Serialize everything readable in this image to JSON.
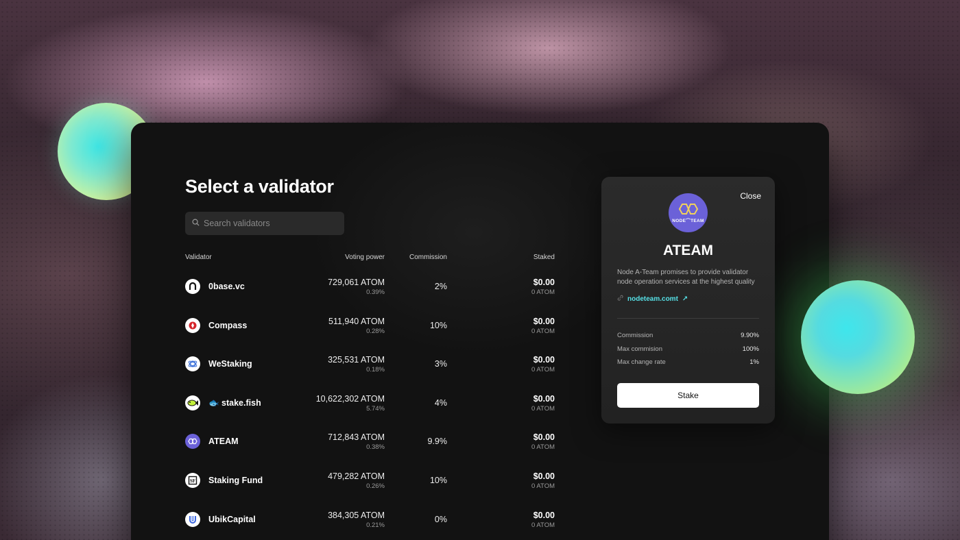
{
  "page": {
    "title": "Select a validator"
  },
  "search": {
    "placeholder": "Search validators"
  },
  "table": {
    "headers": {
      "validator": "Validator",
      "voting_power": "Voting power",
      "commission": "Commission",
      "staked": "Staked"
    },
    "rows": [
      {
        "name": "0base.vc",
        "power": "729,061 ATOM",
        "power_pct": "0.39%",
        "commission": "2%",
        "staked_usd": "$0.00",
        "staked_atom": "0 ATOM",
        "icon": "0base-logo-icon"
      },
      {
        "name": "Compass",
        "power": "511,940 ATOM",
        "power_pct": "0.28%",
        "commission": "10%",
        "staked_usd": "$0.00",
        "staked_atom": "0 ATOM",
        "icon": "compass-logo-icon"
      },
      {
        "name": "WeStaking",
        "power": "325,531 ATOM",
        "power_pct": "0.18%",
        "commission": "3%",
        "staked_usd": "$0.00",
        "staked_atom": "0 ATOM",
        "icon": "westaking-logo-icon"
      },
      {
        "name": "🐟 stake.fish",
        "power": "10,622,302 ATOM",
        "power_pct": "5.74%",
        "commission": "4%",
        "staked_usd": "$0.00",
        "staked_atom": "0 ATOM",
        "icon": "stakefish-logo-icon"
      },
      {
        "name": "ATEAM",
        "power": "712,843 ATOM",
        "power_pct": "0.38%",
        "commission": "9.9%",
        "staked_usd": "$0.00",
        "staked_atom": "0 ATOM",
        "icon": "ateam-logo-icon"
      },
      {
        "name": "Staking Fund",
        "power": "479,282 ATOM",
        "power_pct": "0.26%",
        "commission": "10%",
        "staked_usd": "$0.00",
        "staked_atom": "0 ATOM",
        "icon": "stakingfund-logo-icon"
      },
      {
        "name": "UbikCapital",
        "power": "384,305 ATOM",
        "power_pct": "0.21%",
        "commission": "0%",
        "staked_usd": "$0.00",
        "staked_atom": "0 ATOM",
        "icon": "ubikcapital-logo-icon"
      }
    ]
  },
  "detail": {
    "close_label": "Close",
    "logo_text": "NODE⌒TEAM",
    "name": "ATEAM",
    "description": "Node A-Team promises to provide validator node operation services at the highest quality",
    "link": "nodeteam.comt",
    "stats": [
      {
        "label": "Commission",
        "value": "9.90%"
      },
      {
        "label": "Max commision",
        "value": "100%"
      },
      {
        "label": "Max change rate",
        "value": "1%"
      }
    ],
    "stake_label": "Stake"
  },
  "colors": {
    "accent_link": "#56e0e6",
    "ateam_purple": "#6b61d8",
    "panel_bg": "#121212"
  }
}
